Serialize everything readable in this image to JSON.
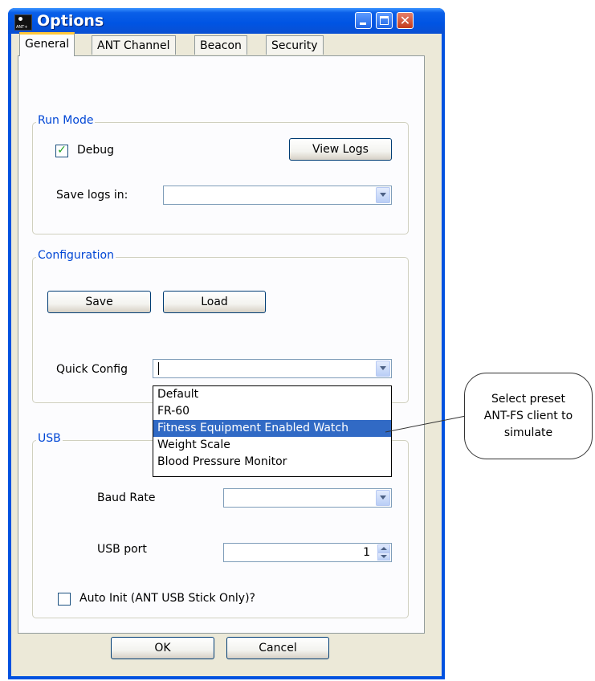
{
  "window": {
    "title": "Options",
    "icon_text": "ANT+"
  },
  "tabs": [
    "General",
    "ANT Channel",
    "Beacon",
    "Security"
  ],
  "run_mode": {
    "legend": "Run Mode",
    "debug_label": "Debug",
    "debug_checked": true,
    "view_logs": "View Logs",
    "save_logs_label": "Save logs in:",
    "save_logs_value": ""
  },
  "configuration": {
    "legend": "Configuration",
    "save": "Save",
    "load": "Load",
    "quick_config_label": "Quick Config",
    "quick_config_value": "",
    "options": [
      "Default",
      "FR-60",
      "Fitness Equipment Enabled Watch",
      "Weight Scale",
      "Blood Pressure Monitor"
    ],
    "selected_index": 2
  },
  "usb": {
    "legend": "USB",
    "baud_rate_label": "Baud Rate",
    "usb_port_label": "USB port",
    "usb_port_value": "1",
    "auto_init_label": "Auto Init (ANT USB Stick Only)?",
    "auto_init_checked": false
  },
  "footer": {
    "ok": "OK",
    "cancel": "Cancel"
  },
  "callout": {
    "lines": [
      "Select preset",
      "ANT-FS client to",
      "simulate"
    ]
  },
  "colors": {
    "title_bar": "#0054e3",
    "group_legend": "#0046d5",
    "selection": "#316ac5",
    "tab_highlight": "#ffc83c"
  }
}
